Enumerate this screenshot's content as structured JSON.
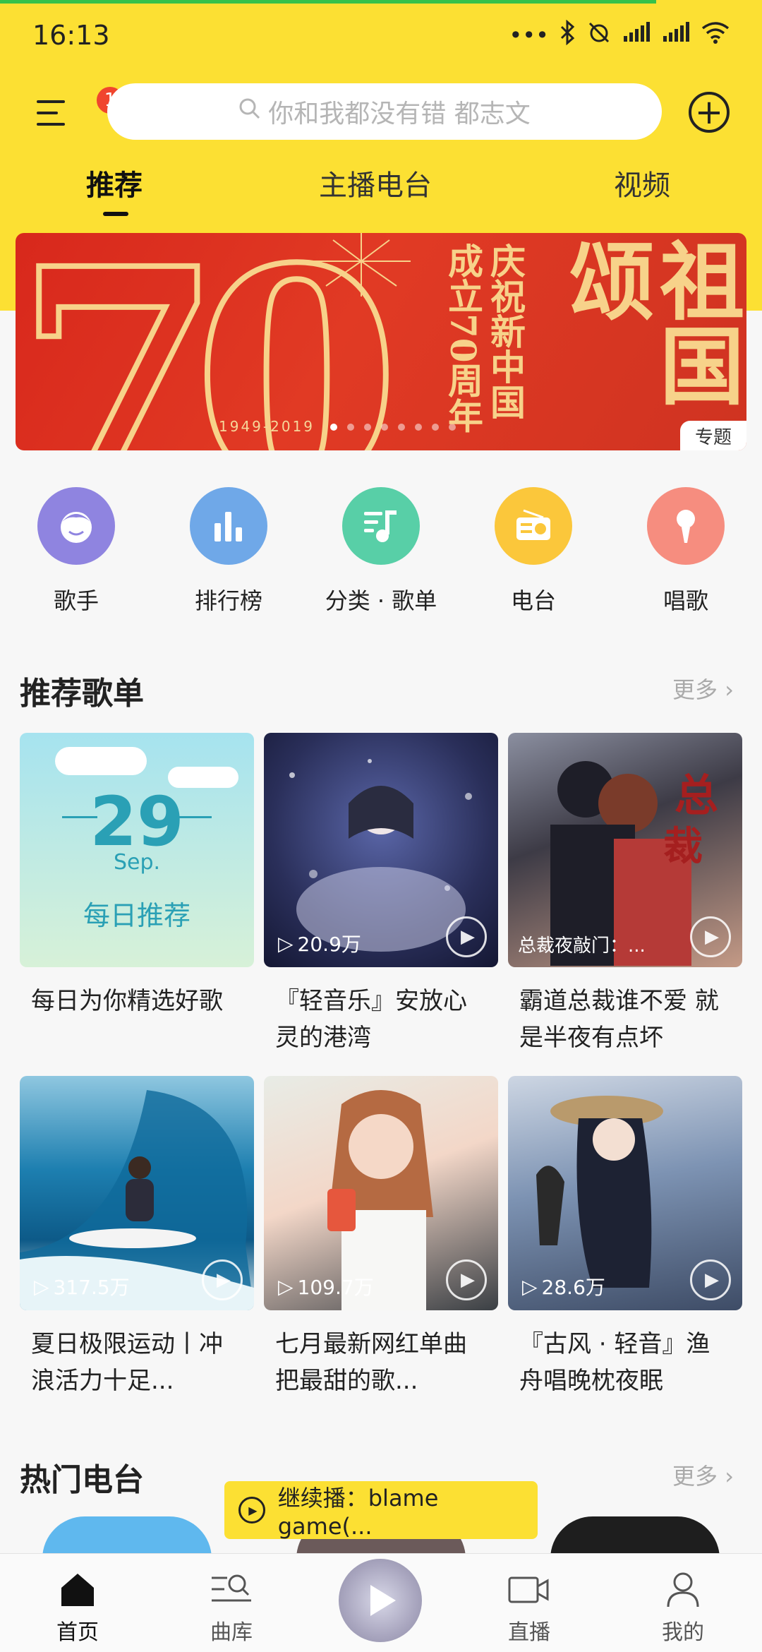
{
  "status_bar": {
    "time": "16:13",
    "icons": [
      "more-dots-icon",
      "bluetooth-icon",
      "mute-alarm-icon",
      "signal-icon",
      "signal-roaming-icon",
      "wifi-icon"
    ]
  },
  "header": {
    "menu_badge": "1",
    "search_placeholder": "你和我都没有错 都志文",
    "tabs": [
      {
        "label": "推荐",
        "active": true
      },
      {
        "label": "主播电台",
        "active": false
      },
      {
        "label": "视频",
        "active": false
      }
    ]
  },
  "banner": {
    "years": "1949-2019",
    "line_left": "成立70周年",
    "line_right": "庆祝新中国",
    "big_text": "祖国颂",
    "tag": "专题",
    "accent": "#f7d28a"
  },
  "shortcuts": [
    {
      "label": "歌手",
      "color": "#8f84e0",
      "icon": "singer-icon"
    },
    {
      "label": "排行榜",
      "color": "#6fa8e8",
      "icon": "chart-bars-icon"
    },
    {
      "label": "分类 · 歌单",
      "color": "#58cfa7",
      "icon": "music-note-list-icon"
    },
    {
      "label": "电台",
      "color": "#fbc73b",
      "icon": "radio-icon"
    },
    {
      "label": "唱歌",
      "color": "#f68d7f",
      "icon": "microphone-icon"
    }
  ],
  "recommend": {
    "title": "推荐歌单",
    "more": "更多",
    "daily": {
      "date": "29",
      "month": "Sep.",
      "label": "每日推荐"
    },
    "items": [
      {
        "title": "每日为你精选好歌",
        "count": ""
      },
      {
        "title": "『轻音乐』安放心灵的港湾",
        "count": "20.9万"
      },
      {
        "title": "霸道总裁谁不爱 就是半夜有点坏",
        "count": "",
        "overlay": "总裁夜敲门：..."
      },
      {
        "title": "夏日极限运动丨冲浪活力十足...",
        "count": "317.5万"
      },
      {
        "title": "七月最新网红单曲 把最甜的歌...",
        "count": "109.7万"
      },
      {
        "title": "『古风 · 轻音』渔舟唱晚枕夜眠",
        "count": "28.6万"
      }
    ]
  },
  "hot_radio": {
    "title": "热门电台",
    "more": "更多"
  },
  "mini_player": {
    "text": "继续播：blame game(..."
  },
  "bottom_nav": [
    {
      "label": "首页",
      "active": true,
      "icon": "home-icon"
    },
    {
      "label": "曲库",
      "active": false,
      "icon": "library-search-icon"
    },
    {
      "label": "直播",
      "active": false,
      "icon": "live-camera-icon"
    },
    {
      "label": "我的",
      "active": false,
      "icon": "profile-icon"
    }
  ],
  "theme": {
    "brand_yellow": "#fce033",
    "badge_red": "#f0452e"
  }
}
